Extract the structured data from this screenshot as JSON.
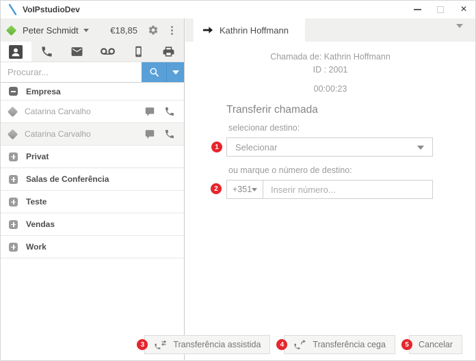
{
  "titlebar": {
    "title": "VoIPstudioDev"
  },
  "icons": {
    "logo": "backslash-stroke",
    "kebab": "⋮",
    "close": "×",
    "minimize": "dash-shape",
    "maximize": "square-shape",
    "collapse": "minus-square",
    "expand": "plus-square"
  },
  "colors": {
    "accent_blue": "#58a0d7",
    "badge_red": "#e5262d",
    "status_green": "#6abf45",
    "status_gray": "#9a9a9a",
    "panel_gray": "#f0f0ee"
  },
  "sidebar": {
    "user": {
      "name": "Peter Schmidt",
      "status": "online",
      "balance": "€18,85"
    },
    "tabs": [
      "contacts",
      "calls",
      "messages",
      "voicemail",
      "mobile",
      "fax"
    ],
    "search": {
      "placeholder": "Procurar..."
    },
    "groups": [
      {
        "label": "Empresa",
        "expanded": true,
        "contacts": [
          {
            "name": "Catarina Carvalho",
            "status": "offline"
          },
          {
            "name": "Catarina Carvalho",
            "status": "offline"
          }
        ]
      },
      {
        "label": "Privat",
        "expanded": false
      },
      {
        "label": "Salas de Conferência",
        "expanded": false
      },
      {
        "label": "Teste",
        "expanded": false
      },
      {
        "label": "Vendas",
        "expanded": false
      },
      {
        "label": "Work",
        "expanded": false
      }
    ]
  },
  "main": {
    "tab": {
      "label": "Kathrin Hoffmann"
    },
    "call": {
      "from_line": "Chamada de: Kathrin Hoffmann",
      "id_line": "ID : 2001",
      "duration": "00:00:23"
    },
    "transfer": {
      "title": "Transferir chamada",
      "select_label": "selecionar destino:",
      "select_placeholder": "Selecionar",
      "select_badge": "1",
      "dial_label": "ou marque o número de destino:",
      "country_code": "+351",
      "number_placeholder": "Inserir número...",
      "dial_badge": "2"
    },
    "footer": {
      "buttons": [
        {
          "badge": "3",
          "label": "Transferência assistida"
        },
        {
          "badge": "4",
          "label": "Transferência cega"
        },
        {
          "badge": "5",
          "label": "Cancelar"
        }
      ]
    }
  }
}
